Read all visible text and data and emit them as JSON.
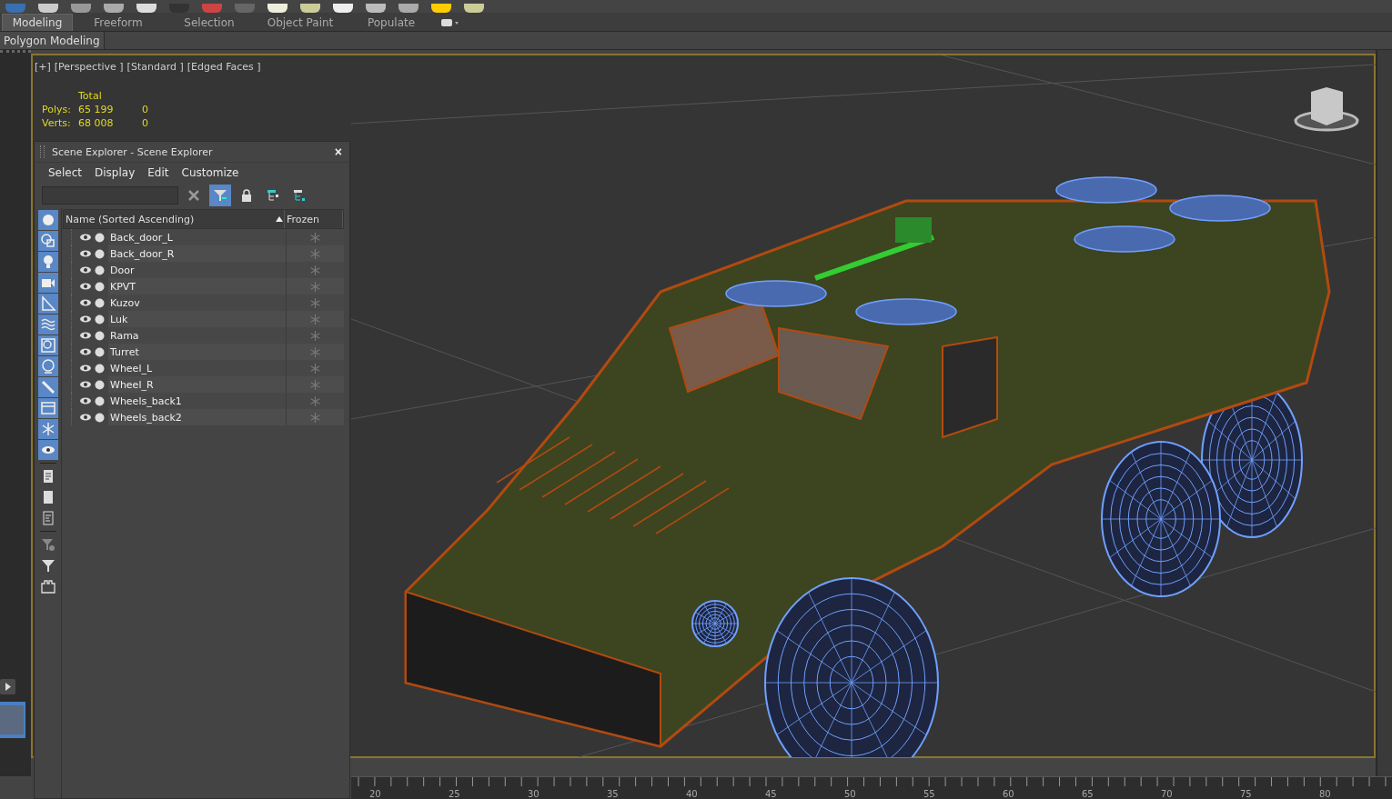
{
  "ribbon": {
    "tabs": [
      {
        "label": "Modeling",
        "selected": true
      },
      {
        "label": "Freeform",
        "selected": false
      },
      {
        "label": "Selection",
        "selected": false
      },
      {
        "label": "Object Paint",
        "selected": false
      },
      {
        "label": "Populate",
        "selected": false
      }
    ],
    "panels": [
      {
        "label": "Polygon Modeling"
      }
    ]
  },
  "viewport": {
    "labels": [
      "[+]",
      "[Perspective ]",
      "[Standard ]",
      "[Edged Faces ]"
    ],
    "stats": {
      "header": "Total",
      "rows": [
        {
          "label": "Polys:",
          "total": "65 199",
          "column_3": "0"
        },
        {
          "label": "Verts:",
          "total": "68 008",
          "column_3": "0"
        }
      ]
    }
  },
  "scene_explorer": {
    "title": "Scene Explorer - Scene Explorer",
    "close": "×",
    "menu": [
      "Select",
      "Display",
      "Edit",
      "Customize"
    ],
    "filter_on": true,
    "filters": [
      {
        "kind": "geometry",
        "on": true
      },
      {
        "kind": "shapes",
        "on": true
      },
      {
        "kind": "lights",
        "on": true
      },
      {
        "kind": "cameras",
        "on": true
      },
      {
        "kind": "helpers",
        "on": true
      },
      {
        "kind": "warps",
        "on": true
      },
      {
        "kind": "groups",
        "on": true
      },
      {
        "kind": "xrefs",
        "on": true
      },
      {
        "kind": "bones",
        "on": true
      },
      {
        "kind": "containers",
        "on": true
      },
      {
        "kind": "frozen",
        "on": true
      },
      {
        "kind": "hidden",
        "on": true
      },
      {
        "kind": "all",
        "on": false
      },
      {
        "kind": "none",
        "on": false
      },
      {
        "kind": "invert",
        "on": false
      },
      {
        "kind": "filtergear",
        "on": false
      },
      {
        "kind": "filter",
        "on": false
      },
      {
        "kind": "frame",
        "on": false
      }
    ],
    "columns": [
      "Name (Sorted Ascending)",
      "Frozen"
    ],
    "rows": [
      {
        "name": "Back_door_L",
        "visible": true,
        "renderable": true,
        "frozen": false
      },
      {
        "name": "Back_door_R",
        "visible": true,
        "renderable": true,
        "frozen": false
      },
      {
        "name": "Door",
        "visible": true,
        "renderable": true,
        "frozen": false
      },
      {
        "name": "KPVT",
        "visible": true,
        "renderable": true,
        "frozen": false
      },
      {
        "name": "Kuzov",
        "visible": true,
        "renderable": true,
        "frozen": false
      },
      {
        "name": "Luk",
        "visible": true,
        "renderable": true,
        "frozen": false
      },
      {
        "name": "Rama",
        "visible": true,
        "renderable": true,
        "frozen": false
      },
      {
        "name": "Turret",
        "visible": true,
        "renderable": true,
        "frozen": false
      },
      {
        "name": "Wheel_L",
        "visible": true,
        "renderable": true,
        "frozen": false
      },
      {
        "name": "Wheel_R",
        "visible": true,
        "renderable": true,
        "frozen": false
      },
      {
        "name": "Wheels_back1",
        "visible": true,
        "renderable": true,
        "frozen": false
      },
      {
        "name": "Wheels_back2",
        "visible": true,
        "renderable": true,
        "frozen": false
      }
    ]
  },
  "timeline": {
    "ticks": [
      "20",
      "25",
      "30",
      "35",
      "40",
      "45",
      "50",
      "55",
      "60",
      "65",
      "70",
      "75",
      "80"
    ]
  }
}
